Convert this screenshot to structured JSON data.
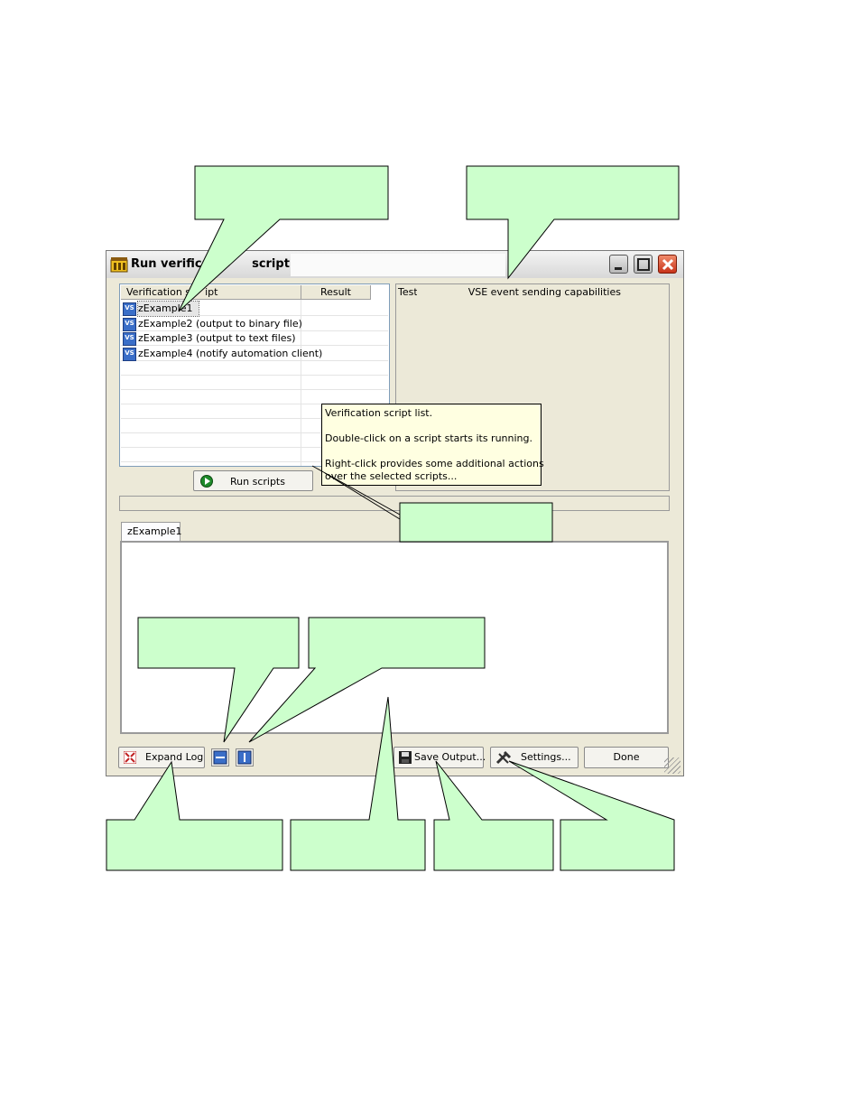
{
  "window": {
    "title": "Run verificat",
    "title_suffix": "script(s) -"
  },
  "script_list": {
    "columns": [
      "Verification sc",
      "ipt",
      "Result"
    ],
    "items": [
      {
        "name": "zExample1",
        "result": ""
      },
      {
        "name": "zExample2 (output to binary file)",
        "result": ""
      },
      {
        "name": "zExample3 (output to text files)",
        "result": ""
      },
      {
        "name": "zExample4 (notify automation client)",
        "result": ""
      }
    ],
    "run_button": "Run scripts"
  },
  "description": {
    "prefix": "Test",
    "text": "r VSE event sending capabilities"
  },
  "tooltip": {
    "line1": "Verification script list.",
    "line2": "Double-click on a script starts its running.",
    "line3a": "Right-click provides some additional actions",
    "line3b": "over the selected scripts..."
  },
  "log": {
    "tab": "zExample1"
  },
  "bottom_bar": {
    "expand_log": "Expand Log",
    "save_output": "Save Output...",
    "settings": "Settings...",
    "done": "Done"
  },
  "colors": {
    "callout_fill": "#ccffcc",
    "tooltip_fill": "#ffffe1",
    "window_face": "#ece9d8",
    "close_button": "#c8331a"
  }
}
